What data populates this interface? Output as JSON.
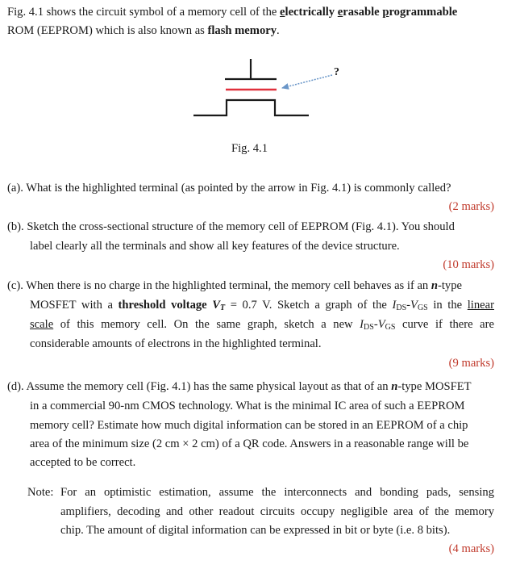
{
  "intro": {
    "line1_pre": "Fig. 4.1 shows the circuit symbol of a memory cell of the ",
    "line1_bold_words": [
      {
        "first": "e",
        "rest": "lectrically"
      },
      {
        "first": "e",
        "rest": "rasable"
      },
      {
        "first": "p",
        "rest": "rogrammable"
      }
    ],
    "line2_pre": "ROM (EEPROM) which is also known as ",
    "line2_bold": "flash memory",
    "line2_post": "."
  },
  "figure": {
    "question_mark": "?",
    "caption": "Fig. 4.1",
    "colors": {
      "symbol": "#1a1a1a",
      "floating_gate": "#e0303c",
      "arrow": "#6a96c8"
    }
  },
  "questions": {
    "a": {
      "text": "(a). What is the highlighted terminal (as pointed by the arrow in Fig. 4.1) is commonly called?",
      "marks": "(2 marks)"
    },
    "b": {
      "line1": "(b). Sketch the cross-sectional structure of the memory cell of EEPROM (Fig. 4.1). You should",
      "line2": "label clearly all the terminals and show all key features of the device structure.",
      "marks": "(10 marks)"
    },
    "c": {
      "line1_pre": "(c). When there is no charge in the highlighted terminal, the memory cell behaves as if an ",
      "n": "n",
      "line1_post": "-type",
      "line2_pre": "MOSFET with a ",
      "line2_bold": "threshold voltage",
      "vt_v": "V",
      "vt_sub": "T",
      "line2_mid": " = 0.7 V. Sketch a graph of the ",
      "ids_i": "I",
      "ids_sub": "DS",
      "dash": "-",
      "vgs_v": "V",
      "vgs_sub": "GS",
      "line2_in": " in the ",
      "line2_underline": "linear",
      "line3_underline": "scale",
      "line3_mid": " of this memory cell. On the same graph, sketch a new ",
      "line3_post": " curve if there are",
      "line4": "considerable amounts of electrons in the highlighted terminal.",
      "marks": "(9 marks)"
    },
    "d": {
      "line1_pre": "(d). Assume the memory cell (Fig. 4.1) has the same physical layout as that of an ",
      "n": "n",
      "line1_post": "-type MOSFET",
      "line2": "in a commercial 90-nm CMOS technology. What is the minimal IC area of such a EEPROM",
      "line3": "memory cell? Estimate how much digital information can be stored in an EEPROM of a chip",
      "line4": "area of the minimum size (2 cm × 2 cm) of a QR code. Answers in a reasonable range will be",
      "line5": "accepted to be correct.",
      "note_label": "Note:",
      "note_line1": "For an optimistic estimation, assume the interconnects and bonding pads, sensing",
      "note_line2": "amplifiers, decoding and other readout circuits occupy negligible area of the memory",
      "note_line3": "chip. The amount of digital information can be expressed in bit or byte (i.e. 8 bits).",
      "marks": "(4 marks)"
    }
  }
}
